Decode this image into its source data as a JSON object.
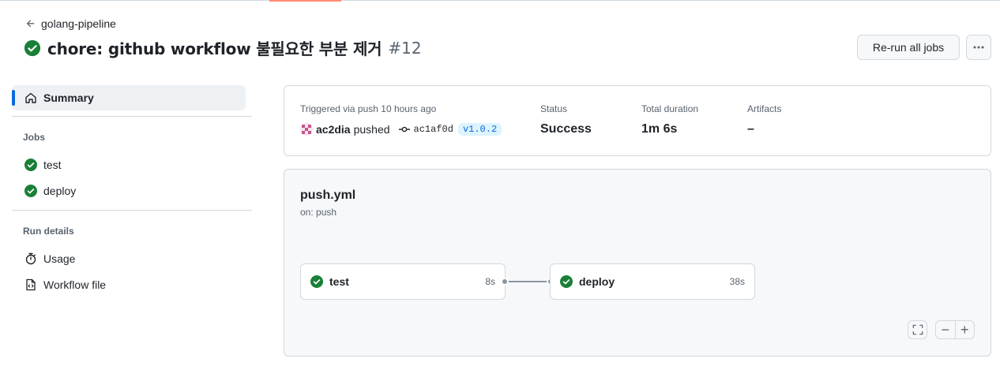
{
  "nav": {
    "back_label": "golang-pipeline"
  },
  "header": {
    "title": "chore: github workflow 불필요한 부분 제거",
    "run_number": "#12",
    "rerun_label": "Re-run all jobs",
    "status_icon": "check-circle-fill-icon"
  },
  "sidebar": {
    "summary_label": "Summary",
    "jobs_heading": "Jobs",
    "jobs": [
      {
        "label": "test",
        "status": "success"
      },
      {
        "label": "deploy",
        "status": "success"
      }
    ],
    "run_details_heading": "Run details",
    "run_details": [
      {
        "label": "Usage",
        "icon": "stopwatch-icon"
      },
      {
        "label": "Workflow file",
        "icon": "file-code-icon"
      }
    ]
  },
  "summary_card": {
    "trigger_label": "Triggered via push 10 hours ago",
    "actor": "ac2dia",
    "action": "pushed",
    "commit_sha": "ac1af0d",
    "tag": "v1.0.2",
    "status_label": "Status",
    "status_value": "Success",
    "duration_label": "Total duration",
    "duration_value": "1m 6s",
    "artifacts_label": "Artifacts",
    "artifacts_value": "–"
  },
  "workflow_graph": {
    "file": "push.yml",
    "trigger": "on: push",
    "jobs": [
      {
        "name": "test",
        "duration": "8s",
        "status": "success"
      },
      {
        "name": "deploy",
        "duration": "38s",
        "status": "success"
      }
    ],
    "zoom_out_label": "−",
    "zoom_in_label": "+"
  },
  "colors": {
    "success": "#1a7f37",
    "accent": "#0969da",
    "tab_underline": "#fd8c73"
  }
}
